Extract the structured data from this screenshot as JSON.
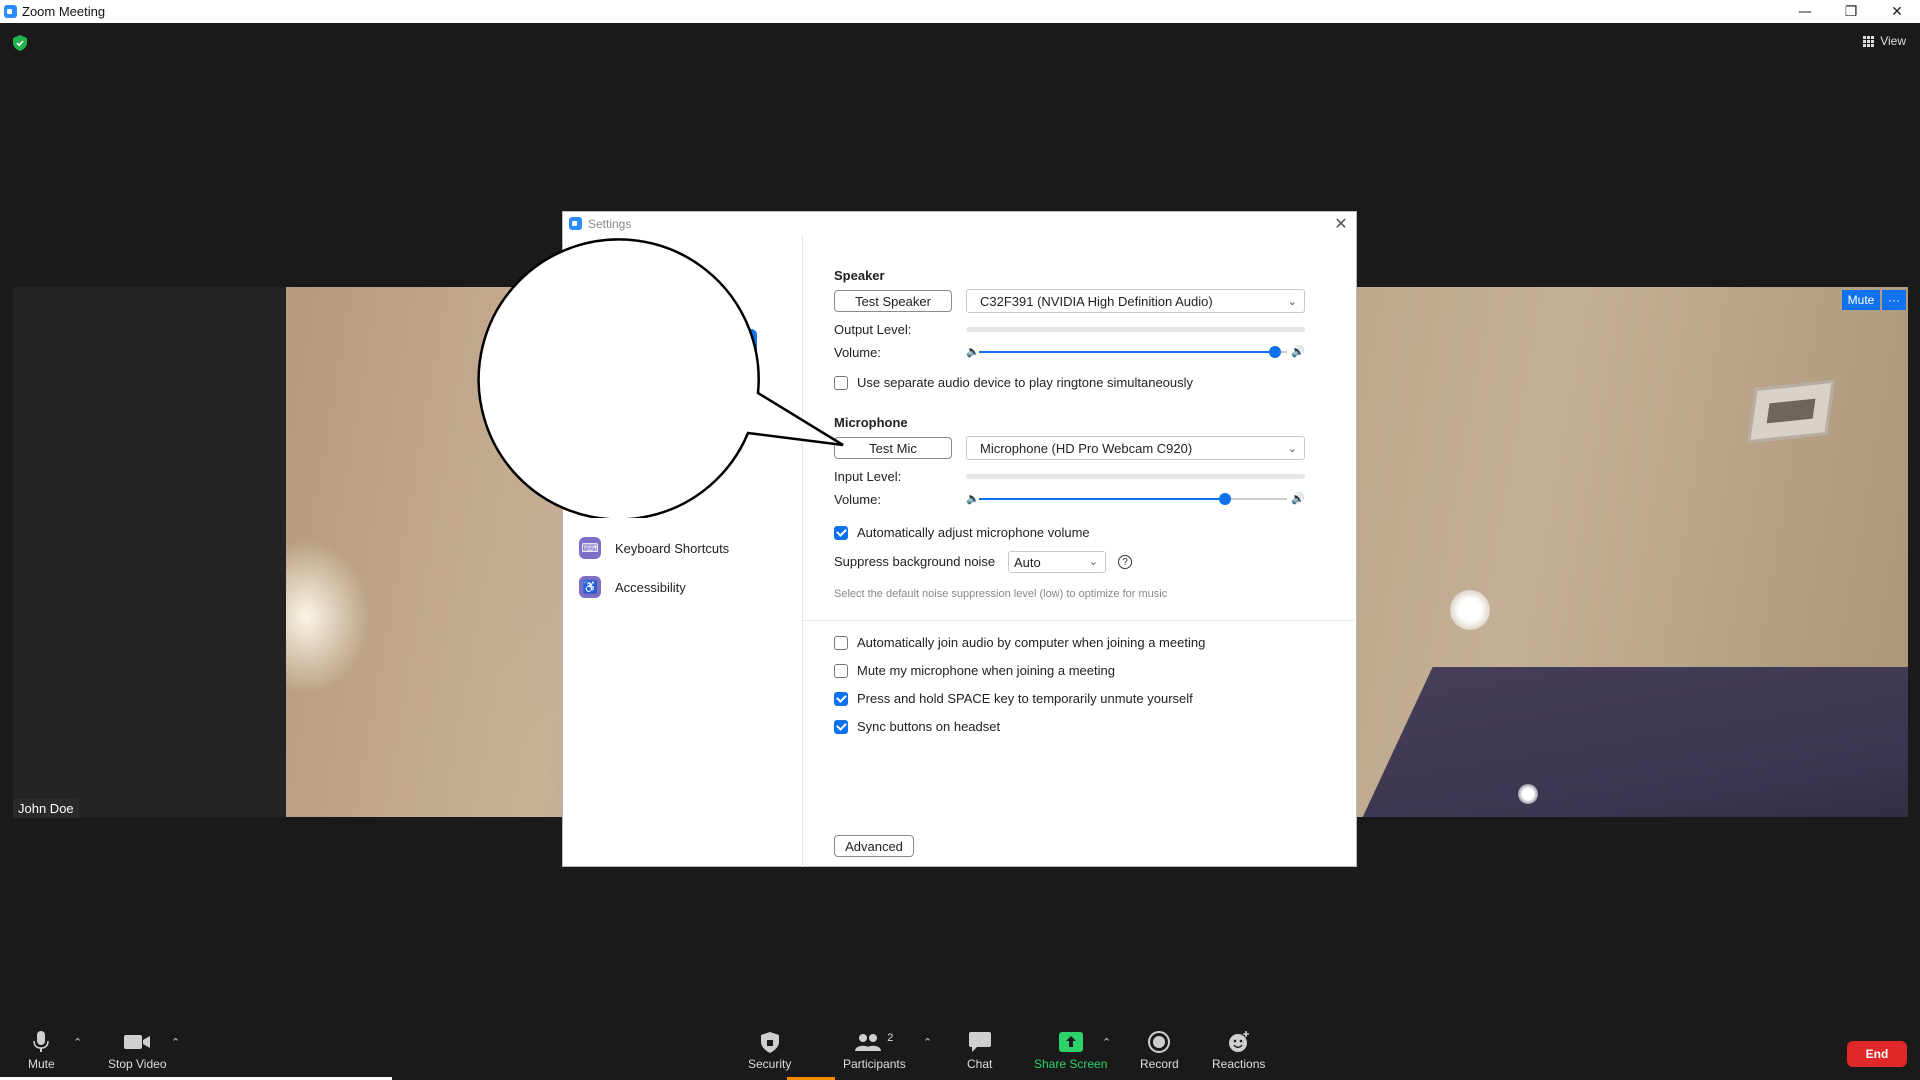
{
  "window": {
    "title": "Zoom Meeting",
    "minimize": "—",
    "restore": "❐",
    "close": "✕"
  },
  "topbar": {
    "view_label": "View"
  },
  "video": {
    "participant_name": "John Doe",
    "mute_label": "Mute",
    "more_label": "···"
  },
  "settings": {
    "title": "Settings",
    "close": "✕",
    "sidebar": [
      {
        "label": "Keyboard Shortcuts",
        "icon": "keyboard-icon"
      },
      {
        "label": "Accessibility",
        "icon": "accessibility-icon"
      }
    ],
    "speaker": {
      "title": "Speaker",
      "test_button": "Test Speaker",
      "device": "C32F391 (NVIDIA High Definition Audio)",
      "output_level_label": "Output Level:",
      "volume_label": "Volume:",
      "volume": 0.96
    },
    "ringtone_checkbox": {
      "label": "Use separate audio device to play ringtone simultaneously",
      "checked": false
    },
    "microphone": {
      "title": "Microphone",
      "test_button": "Test Mic",
      "device": "Microphone (HD Pro Webcam C920)",
      "input_level_label": "Input Level:",
      "volume_label": "Volume:",
      "volume": 0.8
    },
    "auto_adjust": {
      "label": "Automatically adjust microphone volume",
      "checked": true
    },
    "suppress": {
      "label": "Suppress background noise",
      "value": "Auto",
      "help": "?",
      "hint": "Select the default noise suppression level (low) to optimize for music"
    },
    "options": [
      {
        "label": "Automatically join audio by computer when joining a meeting",
        "checked": false
      },
      {
        "label": "Mute my microphone when joining a meeting",
        "checked": false
      },
      {
        "label": "Press and hold SPACE key to temporarily unmute yourself",
        "checked": true
      },
      {
        "label": "Sync buttons on headset",
        "checked": true
      }
    ],
    "advanced_button": "Advanced"
  },
  "toolbar": {
    "mute": "Mute",
    "stop_video": "Stop Video",
    "security": "Security",
    "participants": "Participants",
    "participants_count": "2",
    "chat": "Chat",
    "share_screen": "Share Screen",
    "record": "Record",
    "reactions": "Reactions",
    "end": "End"
  },
  "colors": {
    "accent": "#0e72ed",
    "share_green": "#2dd36a",
    "end_red": "#e02828",
    "background": "#1a1a1a"
  }
}
